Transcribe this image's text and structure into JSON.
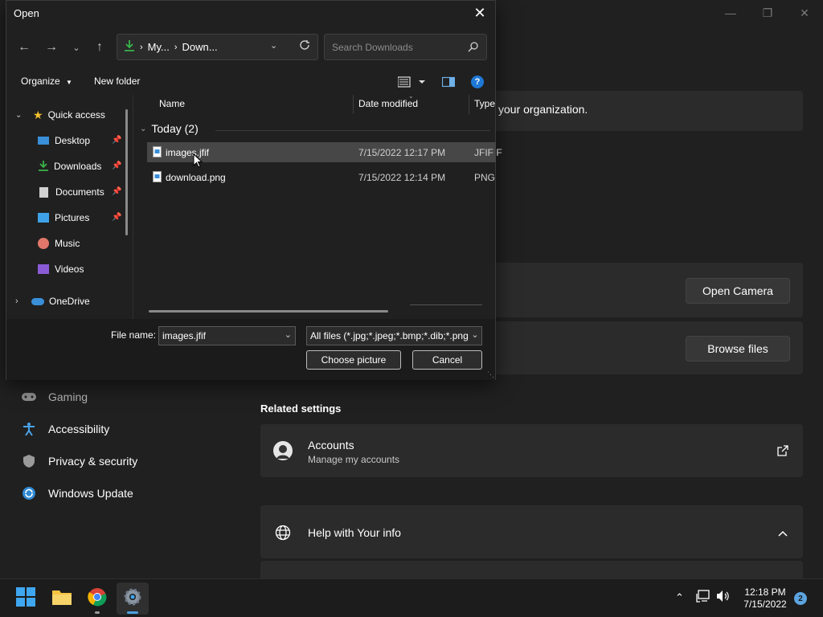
{
  "settings": {
    "org_text": "your organization.",
    "open_camera": "Open Camera",
    "browse_files": "Browse files",
    "nav": [
      {
        "label": "Gaming",
        "icon": "gamepad-icon"
      },
      {
        "label": "Accessibility",
        "icon": "accessibility-icon"
      },
      {
        "label": "Privacy & security",
        "icon": "shield-icon"
      },
      {
        "label": "Windows Update",
        "icon": "update-icon"
      }
    ],
    "related_title": "Related settings",
    "accounts_title": "Accounts",
    "accounts_sub": "Manage my accounts",
    "help_title": "Help with Your info"
  },
  "dialog": {
    "title": "Open",
    "breadcrumb": [
      "My...",
      "Down..."
    ],
    "search_placeholder": "Search Downloads",
    "organize": "Organize",
    "new_folder": "New folder",
    "tree": [
      {
        "label": "Quick access",
        "pinned": false
      },
      {
        "label": "Desktop",
        "pinned": true
      },
      {
        "label": "Downloads",
        "pinned": true
      },
      {
        "label": "Documents",
        "pinned": true
      },
      {
        "label": "Pictures",
        "pinned": true
      },
      {
        "label": "Music",
        "pinned": false
      },
      {
        "label": "Videos",
        "pinned": false
      },
      {
        "label": "OneDrive",
        "pinned": false
      }
    ],
    "columns": [
      "Name",
      "Date modified",
      "Type"
    ],
    "group_label": "Today (2)",
    "files": [
      {
        "name": "images.jfif",
        "date": "7/15/2022 12:17 PM",
        "type": "JFIF F",
        "selected": true
      },
      {
        "name": "download.png",
        "date": "7/15/2022 12:14 PM",
        "type": "PNG",
        "selected": false
      }
    ],
    "file_name_label": "File name:",
    "file_name_value": "images.jfif",
    "filter_value": "All files (*.jpg;*.jpeg;*.bmp;*.dib;*.png",
    "choose_button": "Choose picture",
    "cancel_button": "Cancel"
  },
  "taskbar": {
    "time": "12:18 PM",
    "date": "7/15/2022",
    "notifications": "2"
  }
}
